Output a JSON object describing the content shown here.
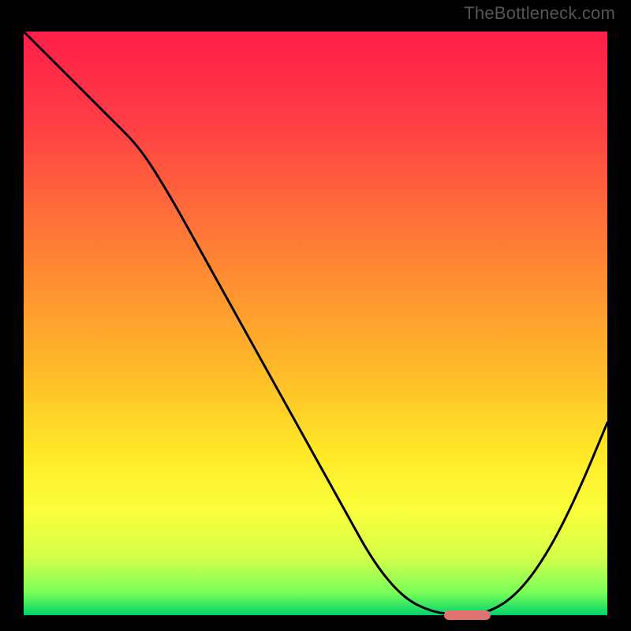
{
  "watermark": "TheBottleneck.com",
  "chart_data": {
    "type": "line",
    "title": "",
    "xlabel": "",
    "ylabel": "",
    "ylim": [
      0,
      100
    ],
    "xlim": [
      0,
      100
    ],
    "x": [
      0,
      5,
      10,
      15,
      20,
      25,
      30,
      35,
      40,
      45,
      50,
      55,
      60,
      65,
      70,
      75,
      80,
      85,
      90,
      95,
      100
    ],
    "values": [
      100,
      95,
      90,
      85,
      80,
      72,
      63,
      54,
      45,
      36,
      27,
      18,
      9,
      3,
      0.5,
      0,
      0.5,
      4,
      11,
      21,
      33
    ],
    "marker": {
      "x_start": 72,
      "x_end": 80,
      "y": 0,
      "color": "#e17272"
    },
    "gradient_stops": [
      {
        "offset": 0.0,
        "color": "#ff1e4a"
      },
      {
        "offset": 0.15,
        "color": "#ff3c45"
      },
      {
        "offset": 0.3,
        "color": "#ff6a3a"
      },
      {
        "offset": 0.45,
        "color": "#ff9530"
      },
      {
        "offset": 0.6,
        "color": "#ffc028"
      },
      {
        "offset": 0.72,
        "color": "#ffe828"
      },
      {
        "offset": 0.82,
        "color": "#fbff3b"
      },
      {
        "offset": 0.9,
        "color": "#d4ff49"
      },
      {
        "offset": 0.96,
        "color": "#7cff58"
      },
      {
        "offset": 1.0,
        "color": "#02d46b"
      }
    ]
  }
}
